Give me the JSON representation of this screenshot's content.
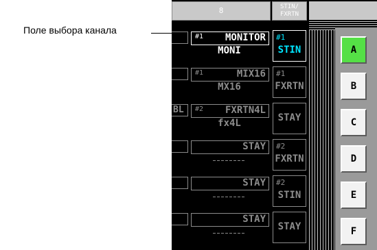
{
  "callout": {
    "text": "Поле выбора канала"
  },
  "header": {
    "channel_number": "8",
    "stin_label_1": "STIN/",
    "stin_label_2": "FXRTN"
  },
  "rows": [
    {
      "num": "#1",
      "name": "MONITOR",
      "short": "MONI",
      "selected": true,
      "left": ""
    },
    {
      "num": "#1",
      "name": "MIX16",
      "short": "MX16",
      "selected": false,
      "left": ""
    },
    {
      "num": "#2",
      "name": "FXRTN4L",
      "short": "fx4L",
      "selected": false,
      "left": "BL"
    },
    {
      "num": "",
      "name": "STAY",
      "short": "",
      "selected": false,
      "left": ""
    },
    {
      "num": "",
      "name": "STAY",
      "short": "",
      "selected": false,
      "left": ""
    },
    {
      "num": "",
      "name": "STAY",
      "short": "",
      "selected": false,
      "left": ""
    }
  ],
  "stin": [
    {
      "num": "#1",
      "value": "STIN",
      "active": true
    },
    {
      "num": "#1",
      "value": "FXRTN",
      "active": false
    },
    {
      "num": "",
      "value": "STAY",
      "active": false
    },
    {
      "num": "#2",
      "value": "FXRTN",
      "active": false
    },
    {
      "num": "#2",
      "value": "STIN",
      "active": false
    },
    {
      "num": "",
      "value": "STAY",
      "active": false
    }
  ],
  "banks": [
    {
      "label": "A",
      "active": true
    },
    {
      "label": "B",
      "active": false
    },
    {
      "label": "C",
      "active": false
    },
    {
      "label": "D",
      "active": false
    },
    {
      "label": "E",
      "active": false
    },
    {
      "label": "F",
      "active": false
    }
  ],
  "colors": {
    "active_bank": "#55e046",
    "active_stin": "#00e5ff",
    "inactive": "#8c8c8c"
  }
}
